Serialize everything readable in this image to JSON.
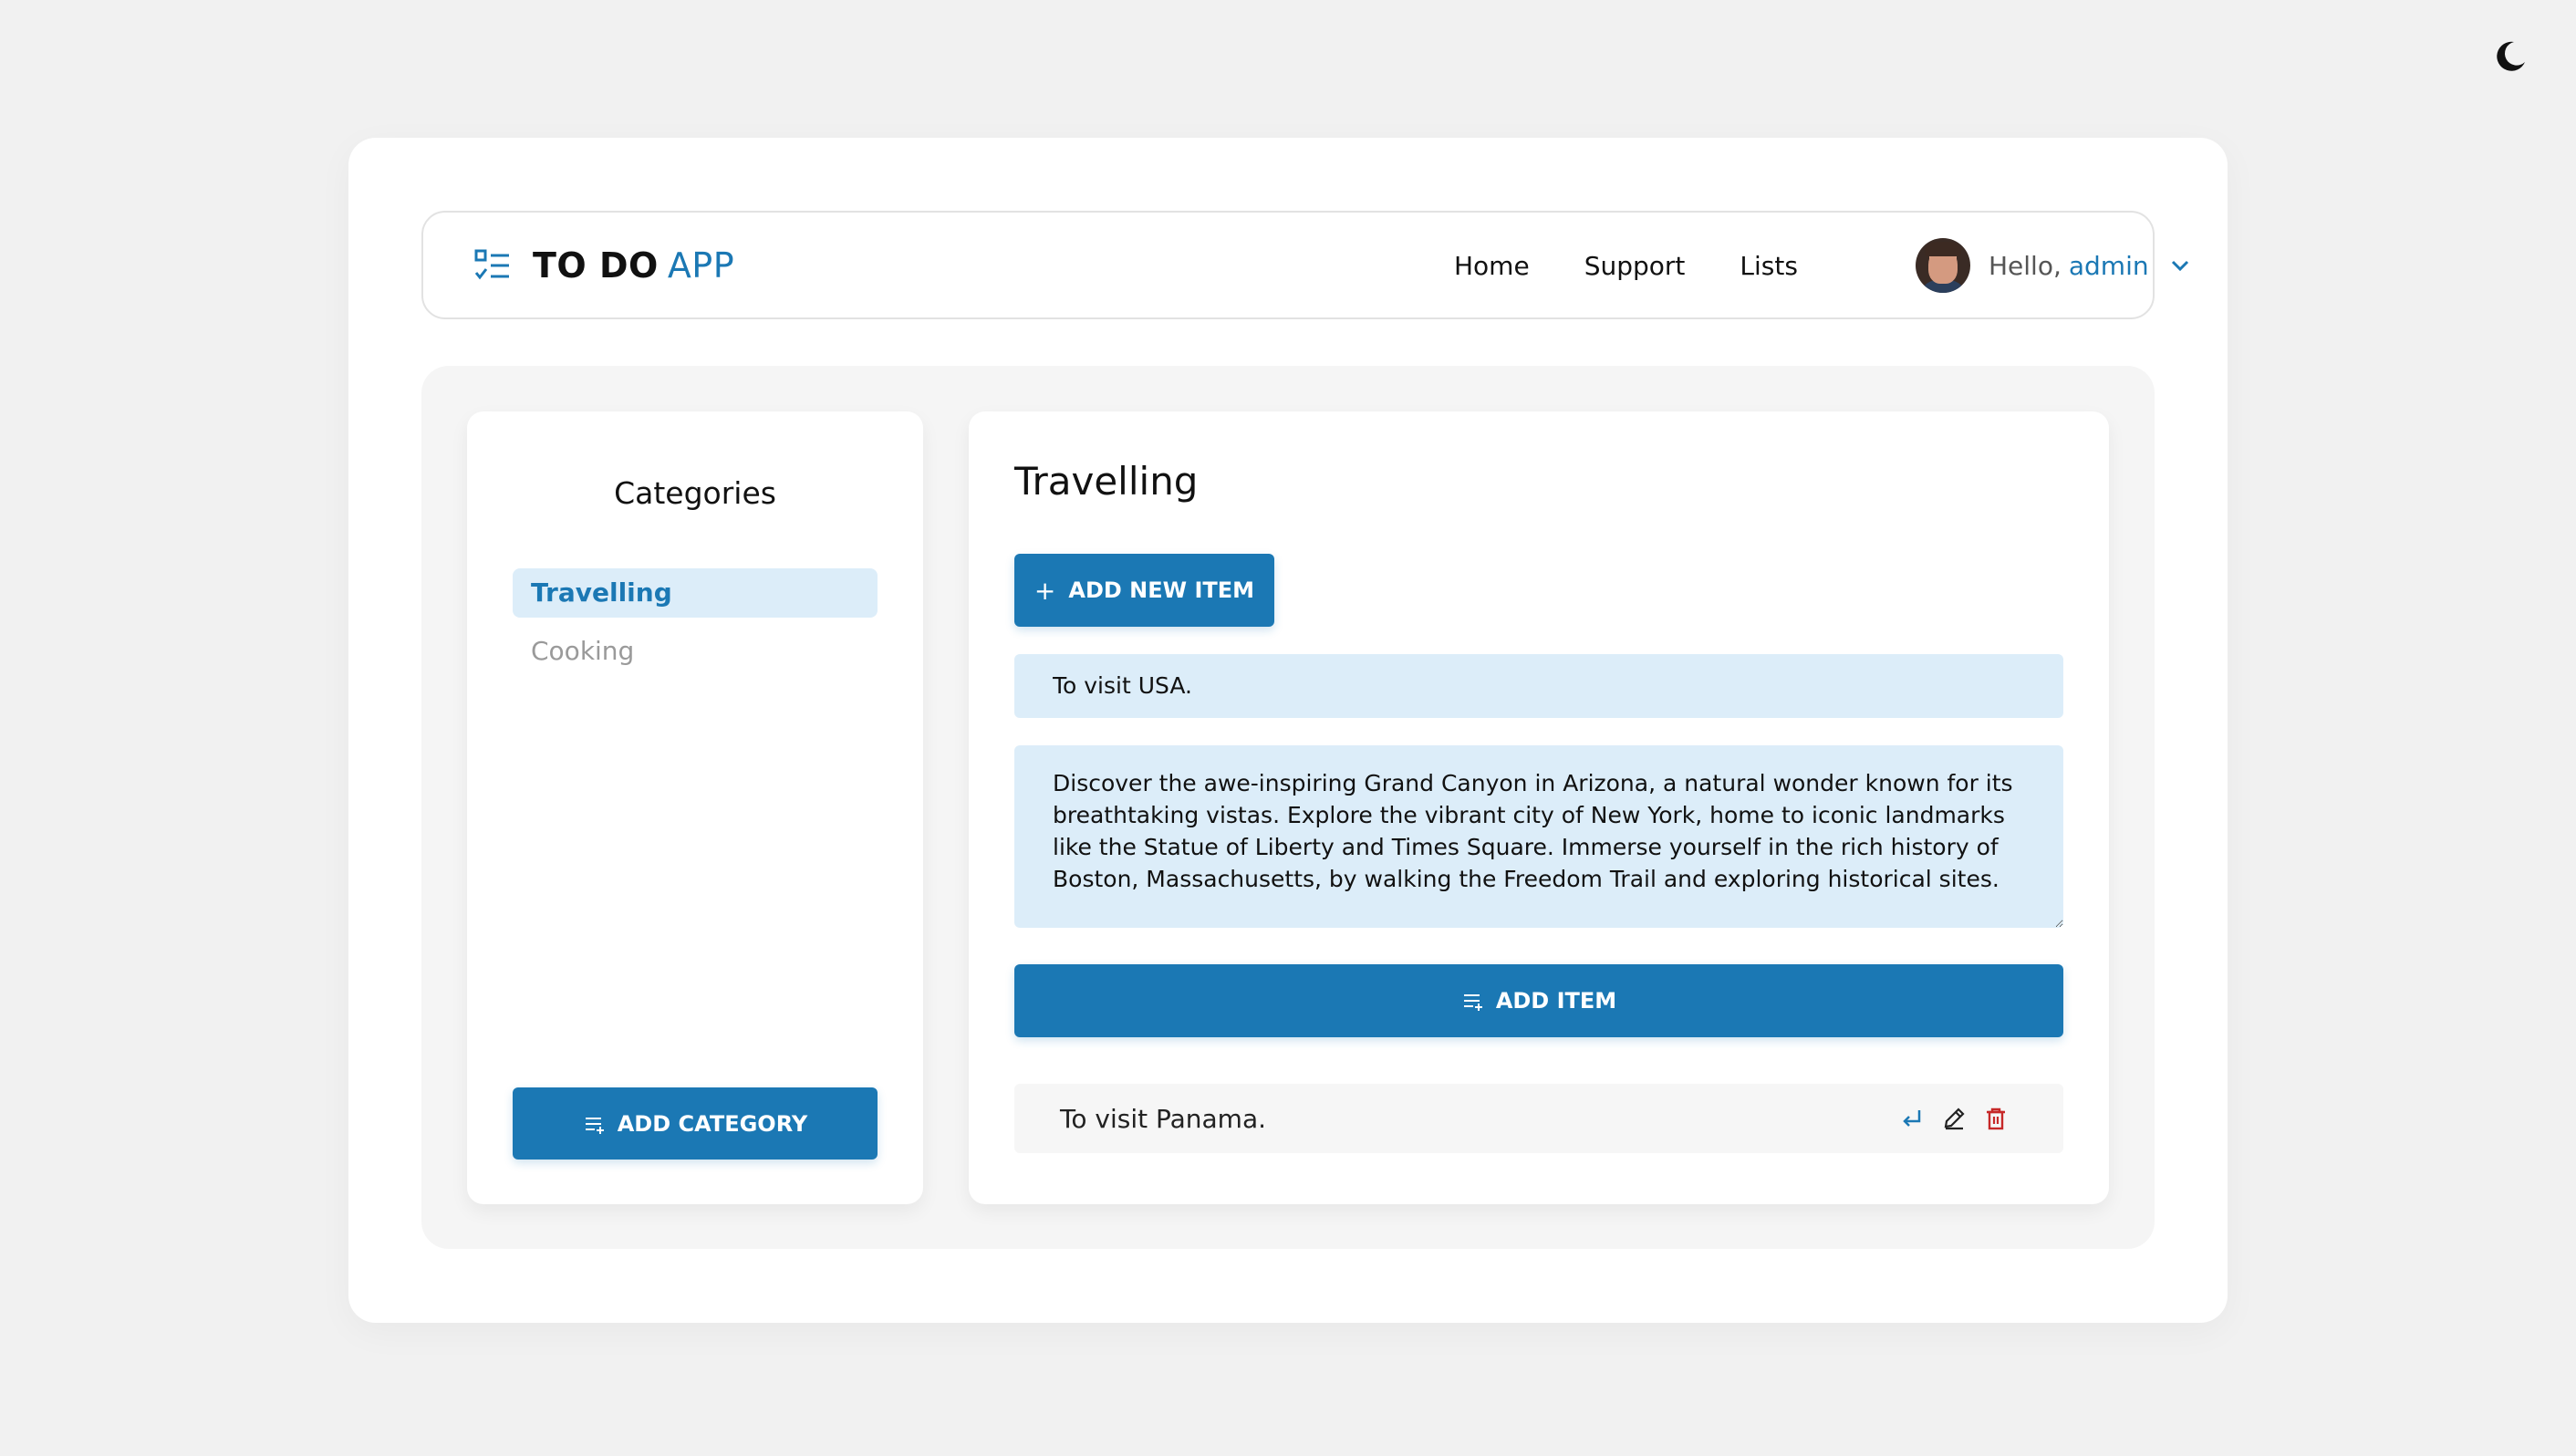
{
  "header": {
    "brand_strong": "TO DO",
    "brand_light": "APP",
    "nav": [
      "Home",
      "Support",
      "Lists"
    ],
    "greeting": "Hello,",
    "username": "admin"
  },
  "sidebar": {
    "title": "Categories",
    "categories": [
      {
        "label": "Travelling",
        "active": true
      },
      {
        "label": "Cooking",
        "active": false
      }
    ],
    "add_category_label": "ADD CATEGORY"
  },
  "main": {
    "title": "Travelling",
    "add_new_item_label": "ADD NEW ITEM",
    "title_input_value": "To visit USA.",
    "description_value": "Discover the awe-inspiring Grand Canyon in Arizona, a natural wonder known for its breathtaking vistas. Explore the vibrant city of New York, home to iconic landmarks like the Statue of Liberty and Times Square. Immerse yourself in the rich history of Boston, Massachusetts, by walking the Freedom Trail and exploring historical sites.",
    "add_item_label": "ADD ITEM",
    "items": [
      {
        "text": "To visit Panama."
      }
    ]
  },
  "colors": {
    "accent": "#1b78b4",
    "accent_light": "#dcedf9",
    "danger": "#c62828",
    "page_bg": "#f1f1f1"
  },
  "icons": {
    "theme_toggle": "moon-icon",
    "brand": "checklist-icon",
    "user_menu": "chevron-down-icon",
    "add_category": "list-add-icon",
    "add_new_item": "plus-icon",
    "add_item": "list-add-icon",
    "item_actions": [
      "return-icon",
      "pencil-icon",
      "trash-icon"
    ]
  }
}
